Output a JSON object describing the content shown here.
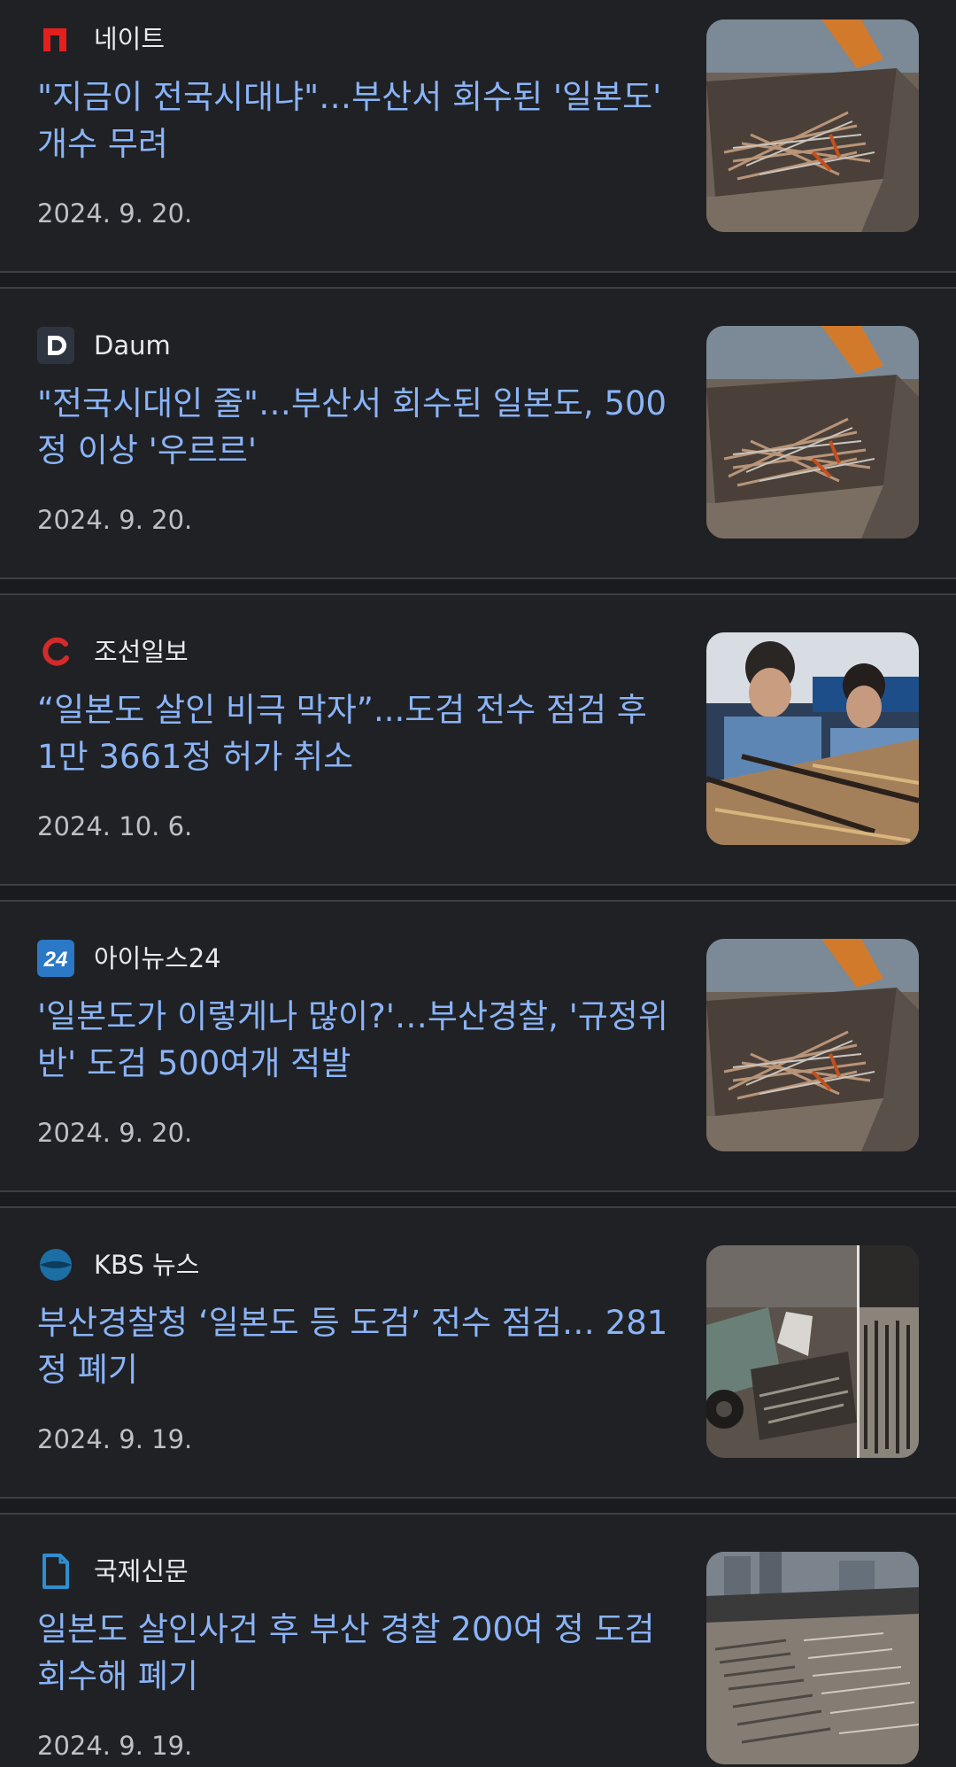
{
  "articles": [
    {
      "source": "네이트",
      "source_icon": "nate-logo-icon",
      "title": "\"지금이 전국시대냐\"…부산서 회수된 '일본도' 개수 무려",
      "date": "2024. 9. 20.",
      "thumbnail": "loader-bucket-swords-image"
    },
    {
      "source": "Daum",
      "source_icon": "daum-logo-icon",
      "title": "\"전국시대인 줄\"…부산서 회수된 일본도, 500정 이상 '우르르'",
      "date": "2024. 9. 20.",
      "thumbnail": "loader-bucket-swords-image"
    },
    {
      "source": "조선일보",
      "source_icon": "chosun-logo-icon",
      "title": "“일본도 살인 비극 막자”...도검 전수 점검 후 1만 3661정 허가 취소",
      "date": "2024. 10. 6.",
      "thumbnail": "police-inspecting-swords-image"
    },
    {
      "source": "아이뉴스24",
      "source_icon": "inews24-logo-icon",
      "title": "'일본도가 이렇게나 많이?'…부산경찰, '규정위반' 도검 500여개 적발",
      "date": "2024. 9. 20.",
      "thumbnail": "loader-bucket-swords-image"
    },
    {
      "source": "KBS 뉴스",
      "source_icon": "kbs-logo-icon",
      "title": "부산경찰청 ‘일본도 등 도검’ 전수 점검… 281정 폐기",
      "date": "2024. 9. 19.",
      "thumbnail": "sword-disposal-truck-image"
    },
    {
      "source": "국제신문",
      "source_icon": "document-icon",
      "title": "일본도 살인사건 후 부산 경찰 200여 정 도검 회수해 폐기",
      "date": "2024. 9. 19.",
      "thumbnail": "swords-laid-on-ground-image"
    }
  ],
  "colors": {
    "background": "#202124",
    "title": "#8ab4f8",
    "source_text": "#e8eaed",
    "date_text": "#bdc1c6",
    "separator": "#3c4043",
    "nate_red": "#e4201e",
    "chosun_red": "#d12b2b",
    "inews_blue": "#2a78c6",
    "kbs_blue": "#1c6ea4",
    "gukje_blue": "#2e8ecf"
  }
}
